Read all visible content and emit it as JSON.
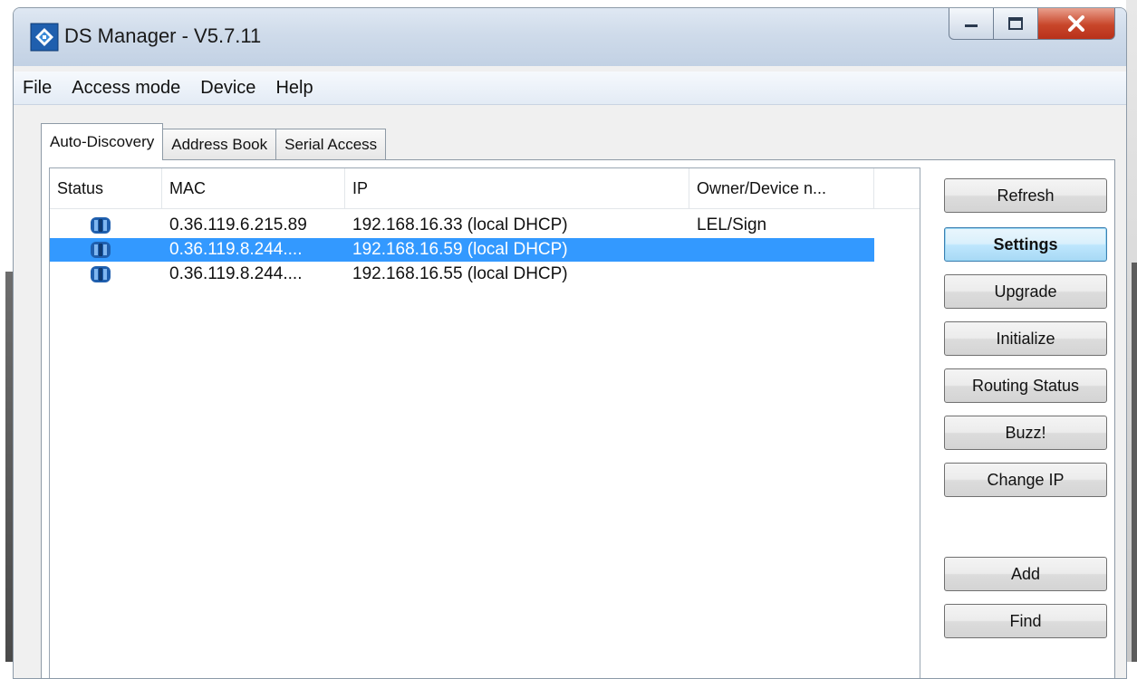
{
  "window": {
    "title": "DS Manager - V5.7.11"
  },
  "menu": [
    "File",
    "Access mode",
    "Device",
    "Help"
  ],
  "tabs": [
    "Auto-Discovery",
    "Address Book",
    "Serial Access"
  ],
  "table": {
    "columns": [
      "Status",
      "MAC",
      "IP",
      "Owner/Device n..."
    ],
    "rows": [
      {
        "mac": "0.36.119.6.215.89",
        "ip": "192.168.16.33 (local DHCP)",
        "owner": "LEL/Sign",
        "status_icon": "device-icon",
        "selected": false
      },
      {
        "mac": "0.36.119.8.244....",
        "ip": "192.168.16.59 (local DHCP)",
        "owner": "",
        "status_icon": "device-icon",
        "selected": true
      },
      {
        "mac": "0.36.119.8.244....",
        "ip": "192.168.16.55 (local DHCP)",
        "owner": "",
        "status_icon": "device-icon",
        "selected": false
      }
    ]
  },
  "buttons": {
    "refresh": "Refresh",
    "settings": "Settings",
    "upgrade": "Upgrade",
    "initialize": "Initialize",
    "routing_status": "Routing Status",
    "buzz": "Buzz!",
    "change_ip": "Change IP",
    "add": "Add",
    "find": "Find"
  },
  "colors": {
    "selection": "#3399ff",
    "titlebar": "#cfdbea",
    "close_button": "#c8462a"
  }
}
